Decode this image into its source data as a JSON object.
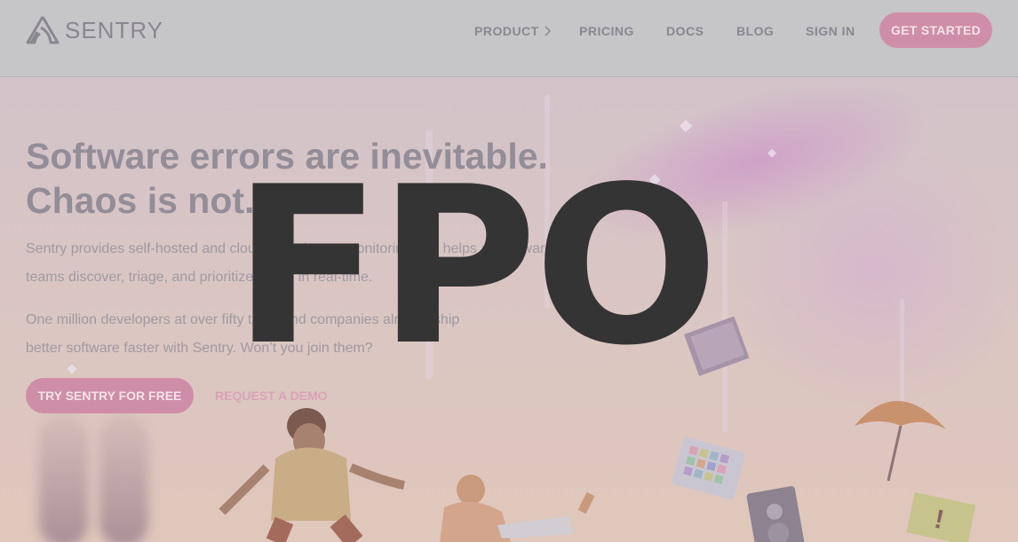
{
  "header": {
    "logo_text": "SENTRY",
    "nav": [
      {
        "label": "PRODUCT",
        "has_chevron": true
      },
      {
        "label": "PRICING"
      },
      {
        "label": "DOCS"
      },
      {
        "label": "BLOG"
      },
      {
        "label": "SIGN IN"
      }
    ],
    "cta_label": "GET STARTED"
  },
  "hero": {
    "headline_line1": "Software errors are inevitable.",
    "headline_line2": "Chaos is not.",
    "para1_line1": "Sentry provides self-hosted and cloud-based error monitoring that helps all software",
    "para1_line2": "teams discover, triage, and prioritize errors in real-time.",
    "para2_line1": "One million developers at over fifty thousand companies already ship",
    "para2_line2": "better software faster with Sentry. Won’t you join them?",
    "primary_button": "TRY SENTRY FOR FREE",
    "secondary_link": "REQUEST A DEMO"
  },
  "overlay": {
    "text": "FPO"
  },
  "colors": {
    "accent": "#cf8ea7",
    "overlay_text": "#343434"
  },
  "icons": [
    "sentry-logo-icon",
    "chevron-right-icon"
  ]
}
